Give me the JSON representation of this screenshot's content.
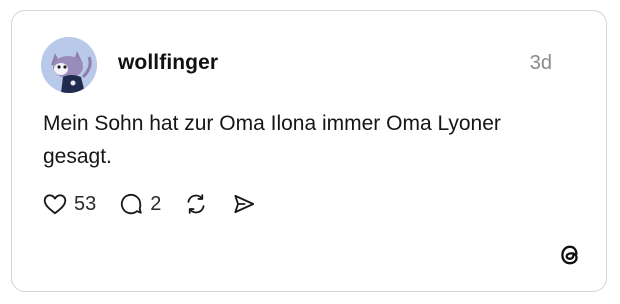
{
  "post": {
    "username": "wollfinger",
    "timestamp": "3d",
    "text": "Mein Sohn hat zur Oma Ilona immer Oma Lyoner gesagt.",
    "likes": "53",
    "replies": "2"
  },
  "icons": {
    "avatar": "cartoon-cat-avatar",
    "like": "heart-icon",
    "reply": "speech-bubble-icon",
    "repost": "repost-icon",
    "share": "send-icon",
    "brand": "threads-logo-icon"
  },
  "colors": {
    "border": "#d4d4d4",
    "text": "#161616",
    "muted": "#8a8a8a",
    "avatar_bg": "#b9c9ea"
  }
}
